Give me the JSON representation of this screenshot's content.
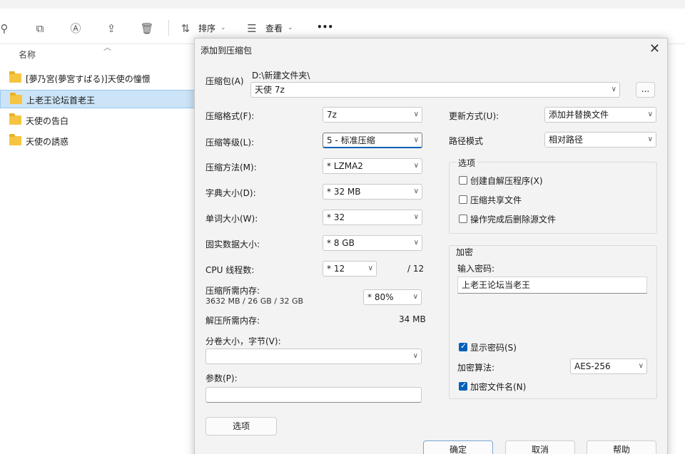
{
  "explorer": {
    "toolbar": {
      "sort_label": "排序",
      "view_label": "查看",
      "more_label": "•••"
    },
    "column_header": "名称",
    "files": [
      "[夢乃宮(夢宮すばる)]天使の憧憬",
      "上老王论坛首老王",
      "天使の告白",
      "天使の誘惑"
    ]
  },
  "dialog": {
    "title": "添加到压缩包",
    "close": "✕",
    "archive_label": "压缩包(A)",
    "archive_path": "D:\\新建文件夹\\",
    "archive_name": "天使 7z",
    "browse_label": "...",
    "format_label": "压缩格式(F):",
    "format_value": "7z",
    "level_label": "压缩等级(L):",
    "level_value": "5 - 标准压缩",
    "method_label": "压缩方法(M):",
    "method_value": "* LZMA2",
    "dict_label": "字典大小(D):",
    "dict_value": "* 32 MB",
    "word_label": "单词大小(W):",
    "word_value": "* 32",
    "solid_label": "固实数据大小:",
    "solid_value": "* 8 GB",
    "cpu_label": "CPU 线程数:",
    "cpu_value": "* 12",
    "cpu_total": "/ 12",
    "mem_comp_label": "压缩所需内存:",
    "mem_comp_detail": "3632 MB / 26 GB / 32 GB",
    "mem_pct_value": "* 80%",
    "mem_decomp_label": "解压所需内存:",
    "mem_decomp_value": "34 MB",
    "split_label": "分卷大小，字节(V):",
    "params_label": "参数(P):",
    "options_button": "选项",
    "update_label": "更新方式(U):",
    "update_value": "添加并替换文件",
    "path_label": "路径模式",
    "path_value": "相对路径",
    "options_group": {
      "title": "选项",
      "sfx": "创建自解压程序(X)",
      "shared": "压缩共享文件",
      "delete_after": "操作完成后删除源文件"
    },
    "encrypt_group": {
      "title": "加密",
      "password_label": "输入密码:",
      "password_value": "上老王论坛当老王",
      "show_password": "显示密码(S)",
      "method_label": "加密算法:",
      "method_value": "AES-256",
      "encrypt_names": "加密文件名(N)"
    },
    "ok_button": "确定",
    "cancel_button": "取消",
    "help_button": "帮助"
  },
  "colors": {
    "accent": "#005fb8",
    "selection": "#cce4f7",
    "folder": "#f5c542"
  }
}
